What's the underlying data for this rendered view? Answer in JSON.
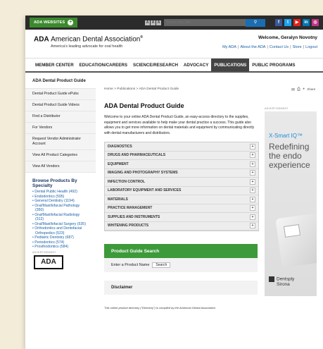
{
  "topbar": {
    "ada_websites": "ADA WEBSITES",
    "text_size": [
      "A",
      "A",
      "A"
    ],
    "search_placeholder": "Search this Site",
    "social": [
      {
        "icon": "facebook-icon",
        "glyph": "f",
        "color": "#3b5998"
      },
      {
        "icon": "twitter-icon",
        "glyph": "t",
        "color": "#1da1f2"
      },
      {
        "icon": "youtube-icon",
        "glyph": "▶",
        "color": "#e62117"
      },
      {
        "icon": "linkedin-icon",
        "glyph": "in",
        "color": "#0077b5"
      },
      {
        "icon": "instagram-icon",
        "glyph": "◎",
        "color": "#c13584"
      }
    ]
  },
  "header": {
    "logo_ada": "ADA",
    "logo_name": "American Dental Association",
    "registered": "®",
    "tagline": "America's leading advocate for oral health",
    "welcome": "Welcome, Geralyn Novotny",
    "links": [
      "My ADA",
      "About the ADA",
      "Contact Us",
      "Store",
      "Logout"
    ]
  },
  "nav": [
    "MEMBER CENTER",
    "EDUCATION/CAREERS",
    "SCIENCE/RESEARCH",
    "ADVOCACY",
    "PUBLICATIONS",
    "PUBLIC PROGRAMS"
  ],
  "nav_active_index": 4,
  "sidebar": {
    "items": [
      "ADA Dental Product Guide",
      "Dental Product Guide ePubs",
      "Dental Product Guide Videos",
      "Find a Distributor",
      "For Vendors",
      "Request Vendor Administrator Account",
      "View All Product Categories",
      "View All Vendors"
    ],
    "browse_title": "Browse Products By Specialty",
    "specialties": [
      "Dental Public Health (492)",
      "Endodontics (595)",
      "General Dentistry (1194)",
      "Oral/Maxillofacial Pathology (350)",
      "Oral/Maxillofacial Radiology (312)",
      "Oral/Maxillofacial Surgery (535)",
      "Orthodontics and Dentofacial Orthopedics (523)",
      "Pediatric Dentistry (687)",
      "Periodontics (574)",
      "Prosthodontics (584)"
    ],
    "advertisement": "ADVERTISEMENT",
    "badge": "ADA"
  },
  "main": {
    "breadcrumb": "Home >  Publications >  ADA Dental Product Guide",
    "title": "ADA Dental Product Guide",
    "intro": "Welcome to your online ADA Dental Product Guide, an easy-access directory to the supplies, equipment and services available to help make your dental practice a success. This guide also allows you to get more information on dental materials and equipment by communicating directly with dental manufacturers and distributors.",
    "categories": [
      "DIAGNOSTICS",
      "DRUGS AND PHARMACEUTICALS",
      "EQUIPMENT",
      "IMAGING AND PHOTOGRAPHY SYSTEMS",
      "INFECTION CONTROL",
      "LABORATORY EQUIPMENT AND SERVICES",
      "MATERIALS",
      "PRACTICE MANAGEMENT",
      "SUPPLIES AND INSTRUMENTS",
      "WHITENING PRODUCTS"
    ],
    "search_title": "Product Guide Search",
    "search_label": "Enter a Product Name",
    "search_button": "Search",
    "disclaimer": "Disclaimer",
    "footnote": "This online product directory (\"Directory\") is compiled by the American Dental Association"
  },
  "utility": {
    "share": "Share"
  },
  "ad": {
    "label": "ADVERTISEMENT",
    "brand": "X-Smart IQ™",
    "headline": "Redefining the endo experience",
    "sponsor_line1": "Dentsply",
    "sponsor_line2": "Sirona"
  },
  "colors": {
    "green": "#3c8a2e",
    "nav_active": "#444444",
    "link": "#1a5fa8"
  }
}
